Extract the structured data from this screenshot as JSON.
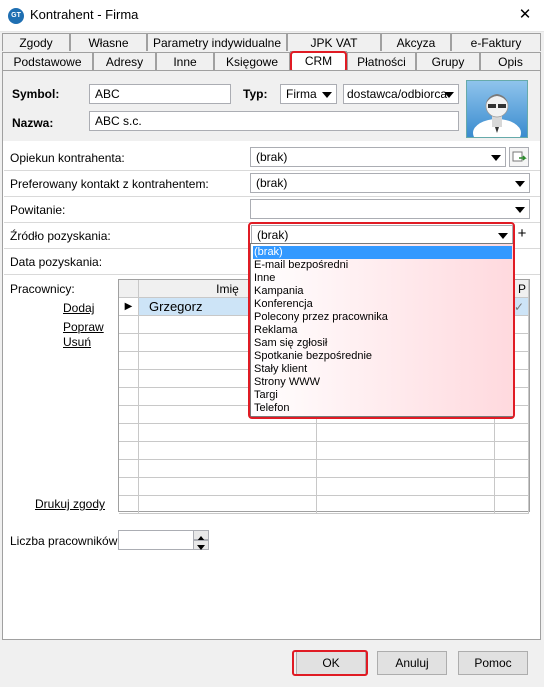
{
  "window": {
    "title": "Kontrahent - Firma",
    "icon_text": "GT",
    "close_glyph": "✕"
  },
  "tabs_row1": [
    "Zgody",
    "Własne",
    "Parametry indywidualne",
    "JPK VAT",
    "Akcyza",
    "e-Faktury"
  ],
  "tabs_row2": [
    "Podstawowe",
    "Adresy",
    "Inne",
    "Księgowe",
    "CRM",
    "Płatności",
    "Grupy",
    "Opis"
  ],
  "active_tab": "CRM",
  "header": {
    "symbol_label": "Symbol:",
    "symbol_value": "ABC",
    "typ_label": "Typ:",
    "typ_value": "Firma",
    "typ2_value": "dostawca/odbiorca",
    "nazwa_label": "Nazwa:",
    "nazwa_value": "ABC s.c."
  },
  "fields": {
    "opiekun_label": "Opiekun kontrahenta:",
    "opiekun_value": "(brak)",
    "kontakt_label": "Preferowany kontakt z kontrahentem:",
    "kontakt_value": "(brak)",
    "powitanie_label": "Powitanie:",
    "powitanie_value": "",
    "zrodlo_label": "Źródło pozyskania:",
    "zrodlo_value": "(brak)",
    "data_label": "Data pozyskania:"
  },
  "source_options": [
    "(brak)",
    "E-mail bezpośredni",
    "Inne",
    "Kampania",
    "Konferencja",
    "Polecony przez pracownika",
    "Reklama",
    "Sam się zgłosił",
    "Spotkanie bezpośrednie",
    "Stały klient",
    "Strony WWW",
    "Targi",
    "Telefon"
  ],
  "source_selected": "(brak)",
  "pracownicy": {
    "label": "Pracownicy:",
    "actions": {
      "add": "Dodaj",
      "edit": "Popraw",
      "delete": "Usuń",
      "print": "Drukuj zgody"
    },
    "column_header": "Imię",
    "last_col_glyph": "P",
    "rows": [
      {
        "imie": "Grzegorz",
        "check": "✓"
      }
    ]
  },
  "liczba": {
    "label": "Liczba pracowników:",
    "value": ""
  },
  "buttons": {
    "ok": "OK",
    "cancel": "Anuluj",
    "help": "Pomoc"
  },
  "colors": {
    "highlight": "#e01b24",
    "selection": "#3399ff"
  }
}
